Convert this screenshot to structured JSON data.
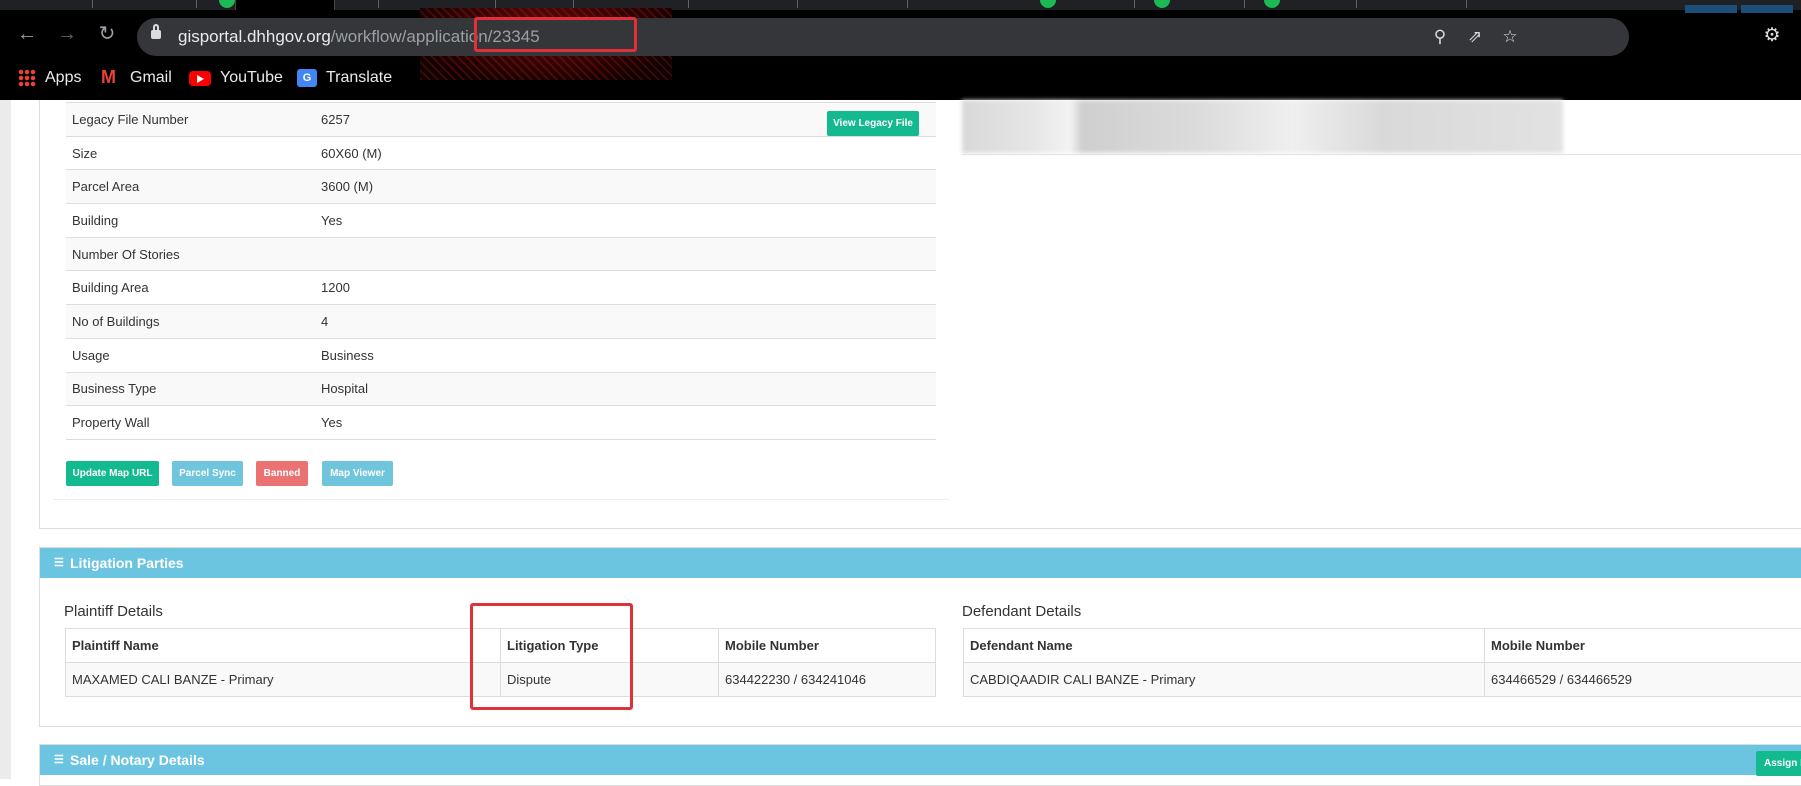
{
  "browser": {
    "url_host": "gisportal.dhhgov.org",
    "url_path": "/workflow/application/23345",
    "bookmarks": [
      {
        "label": "Apps",
        "icon": "apps-grid-icon"
      },
      {
        "label": "Gmail",
        "icon": "gmail-icon"
      },
      {
        "label": "YouTube",
        "icon": "youtube-icon"
      },
      {
        "label": "Translate",
        "icon": "google-translate-icon"
      }
    ]
  },
  "property": {
    "rows": [
      {
        "label": "Legacy File Number",
        "value": "6257"
      },
      {
        "label": "Size",
        "value": "60X60 (M)"
      },
      {
        "label": "Parcel Area",
        "value": "3600 (M)"
      },
      {
        "label": "Building",
        "value": "Yes"
      },
      {
        "label": "Number Of Stories",
        "value": ""
      },
      {
        "label": "Building Area",
        "value": "1200"
      },
      {
        "label": "No of Buildings",
        "value": "4"
      },
      {
        "label": "Usage",
        "value": "Business"
      },
      {
        "label": "Business Type",
        "value": "Hospital"
      },
      {
        "label": "Property Wall",
        "value": "Yes"
      }
    ],
    "view_legacy_label": "View Legacy File",
    "actions": {
      "update_map_url": "Update Map URL",
      "parcel_sync": "Parcel Sync",
      "banned": "Banned",
      "map_viewer": "Map Viewer"
    }
  },
  "litigation": {
    "title": "Litigation Parties",
    "plaintiff_heading": "Plaintiff Details",
    "plaintiff_columns": [
      "Plaintiff Name",
      "Litigation Type",
      "Mobile Number"
    ],
    "plaintiff_rows": [
      [
        "MAXAMED CALI BANZE - Primary",
        "Dispute",
        "634422230 / 634241046"
      ]
    ],
    "defendant_heading": "Defendant Details",
    "defendant_columns": [
      "Defendant Name",
      "Mobile Number"
    ],
    "defendant_rows": [
      [
        "CABDIQAADIR CALI BANZE - Primary",
        "634466529 / 634466529"
      ]
    ]
  },
  "sale": {
    "title": "Sale / Notary Details",
    "assign_label": "Assign N"
  },
  "colors": {
    "success": "#13b98f",
    "info": "#6fc6dc",
    "danger": "#eb7272",
    "panel_header": "#6cc5e0",
    "highlight": "#e0303a"
  }
}
